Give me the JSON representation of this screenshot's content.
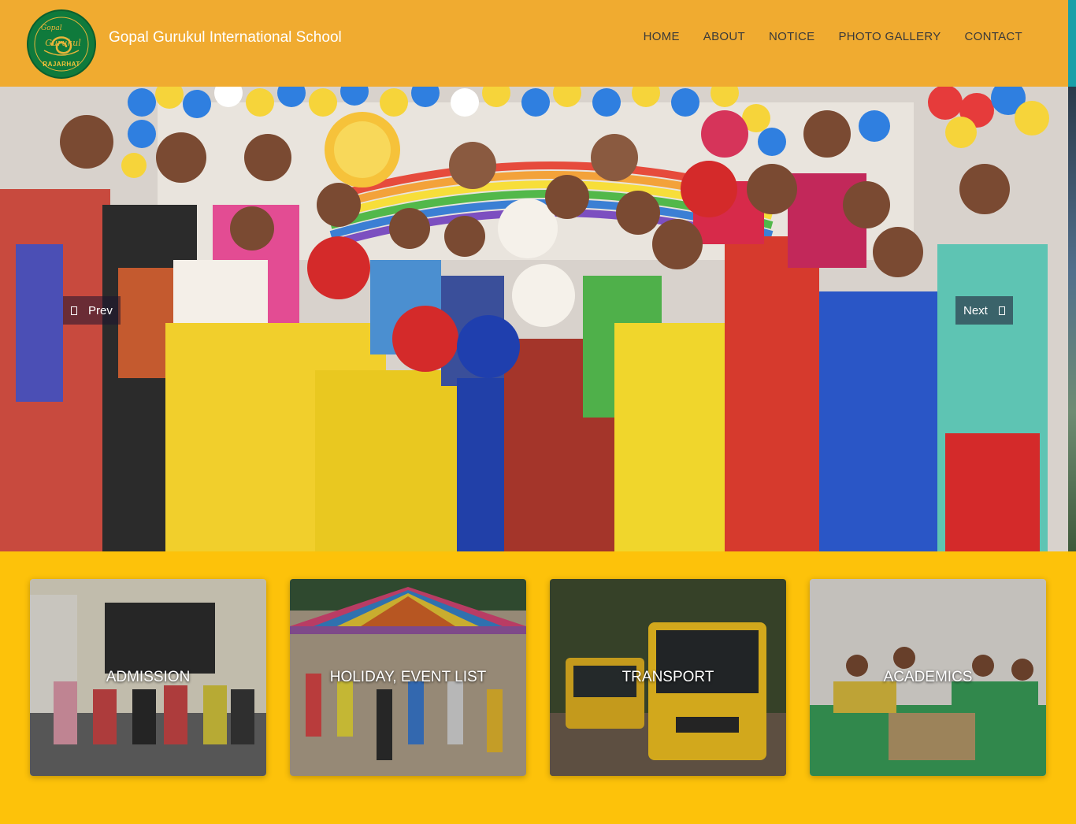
{
  "header": {
    "logo": {
      "icon": "school-crest-logo",
      "text_top": "Gopal",
      "text_main": "Gurukul",
      "text_bottom": "RAJARHAT"
    },
    "site_title": "Gopal Gurukul International School",
    "nav": [
      {
        "label": "HOME"
      },
      {
        "label": "ABOUT"
      },
      {
        "label": "NOTICE"
      },
      {
        "label": "PHOTO GALLERY"
      },
      {
        "label": "CONTACT"
      }
    ]
  },
  "slider": {
    "prev_label": "Prev",
    "next_label": "Next",
    "prev_icon": "chevron-left-icon",
    "next_icon": "chevron-right-icon"
  },
  "cards": [
    {
      "label": "ADMISSION"
    },
    {
      "label": "HOLIDAY, EVENT LIST"
    },
    {
      "label": "TRANSPORT"
    },
    {
      "label": "ACADEMICS"
    }
  ],
  "colors": {
    "header_bg": "#f0ab30",
    "page_bg": "#fdc20a",
    "logo_green": "#0f7a3c",
    "nav_text": "#3a3a3a"
  }
}
